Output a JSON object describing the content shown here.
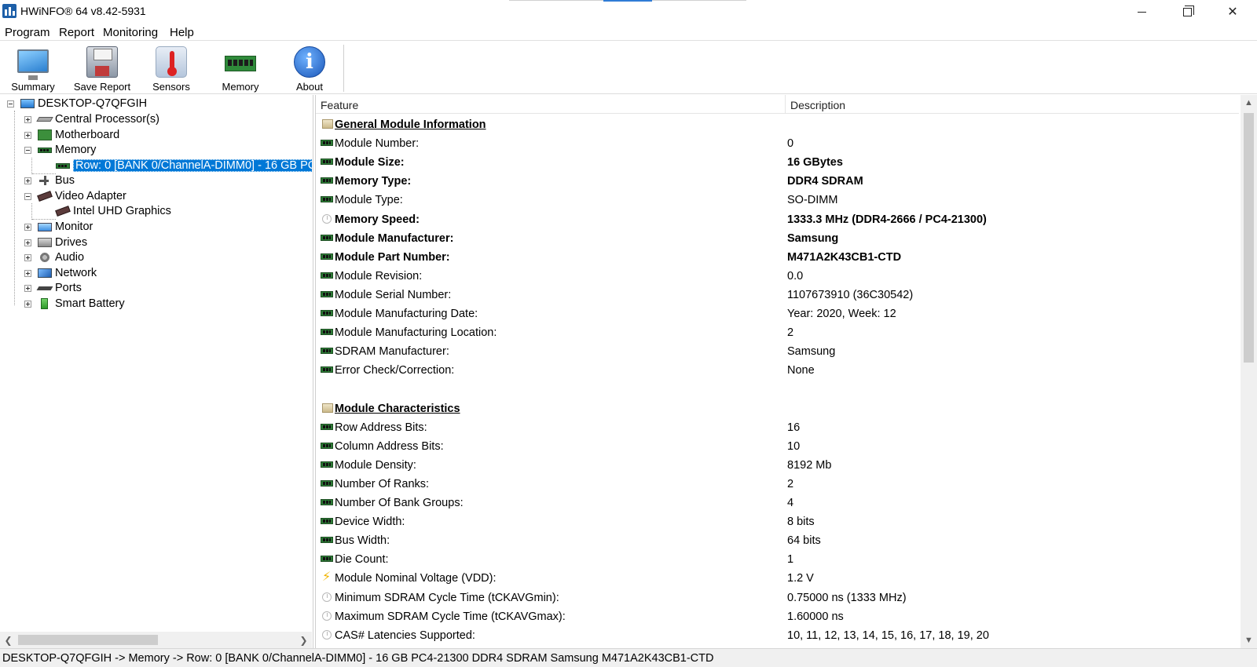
{
  "window": {
    "title": "HWiNFO® 64 v8.42-5931",
    "minimize_glyph": "—",
    "close_glyph": "✕"
  },
  "menu": [
    "Program",
    "Report",
    "Monitoring",
    "Help"
  ],
  "toolbar": [
    {
      "label": "Summary",
      "icon": "monitor-icon"
    },
    {
      "label": "Save Report",
      "icon": "floppy-disk-icon"
    },
    {
      "label": "Sensors",
      "icon": "thermometer-icon"
    },
    {
      "label": "Memory",
      "icon": "ram-module-icon"
    },
    {
      "label": "About",
      "icon": "info-icon"
    }
  ],
  "about_glyph": "i",
  "tree": {
    "root": "DESKTOP-Q7QFGIH",
    "items": [
      {
        "label": "Central Processor(s)",
        "icon": "cpu-icon",
        "expanded": false
      },
      {
        "label": "Motherboard",
        "icon": "motherboard-icon",
        "expanded": false
      },
      {
        "label": "Memory",
        "icon": "ram-module-icon",
        "expanded": true
      },
      {
        "label": "Row: 0 [BANK 0/ChannelA-DIMM0] - 16 GB PC4-21300 DDR4 SDRAM Samsung M471A2K43CB1-CTD",
        "icon": "ram-module-icon",
        "child": true,
        "selected": true
      },
      {
        "label": "Bus",
        "icon": "bus-icon",
        "expanded": false
      },
      {
        "label": "Video Adapter",
        "icon": "gpu-icon",
        "expanded": true
      },
      {
        "label": "Intel UHD Graphics",
        "icon": "gpu-icon",
        "child": true
      },
      {
        "label": "Monitor",
        "icon": "monitor-icon",
        "expanded": false
      },
      {
        "label": "Drives",
        "icon": "drive-icon",
        "expanded": false
      },
      {
        "label": "Audio",
        "icon": "speaker-icon",
        "expanded": false
      },
      {
        "label": "Network",
        "icon": "network-icon",
        "expanded": false
      },
      {
        "label": "Ports",
        "icon": "port-icon",
        "expanded": false
      },
      {
        "label": "Smart Battery",
        "icon": "battery-icon",
        "expanded": false
      }
    ]
  },
  "details": {
    "columns": {
      "feature": "Feature",
      "description": "Description"
    },
    "rows": [
      {
        "type": "section",
        "feature": "General Module Information",
        "description": ""
      },
      {
        "icon": "ram",
        "feature": "Module Number:",
        "description": "0"
      },
      {
        "icon": "ram",
        "feature": "Module Size:",
        "description": "16 GBytes",
        "bold": true
      },
      {
        "icon": "ram",
        "feature": "Memory Type:",
        "description": "DDR4 SDRAM",
        "bold": true
      },
      {
        "icon": "ram",
        "feature": "Module Type:",
        "description": "SO-DIMM"
      },
      {
        "icon": "clock",
        "feature": "Memory Speed:",
        "description": "1333.3 MHz (DDR4-2666 / PC4-21300)",
        "bold": true
      },
      {
        "icon": "ram",
        "feature": "Module Manufacturer:",
        "description": "Samsung",
        "bold": true
      },
      {
        "icon": "ram",
        "feature": "Module Part Number:",
        "description": "M471A2K43CB1-CTD",
        "bold": true
      },
      {
        "icon": "ram",
        "feature": "Module Revision:",
        "description": "0.0"
      },
      {
        "icon": "ram",
        "feature": "Module Serial Number:",
        "description": "1107673910 (36C30542)"
      },
      {
        "icon": "ram",
        "feature": "Module Manufacturing Date:",
        "description": "Year: 2020, Week: 12"
      },
      {
        "icon": "ram",
        "feature": "Module Manufacturing Location:",
        "description": "2"
      },
      {
        "icon": "ram",
        "feature": "SDRAM Manufacturer:",
        "description": "Samsung"
      },
      {
        "icon": "ram",
        "feature": "Error Check/Correction:",
        "description": "None"
      },
      {
        "type": "blank",
        "feature": "",
        "description": ""
      },
      {
        "type": "section",
        "feature": "Module Characteristics",
        "description": ""
      },
      {
        "icon": "ram",
        "feature": "Row Address Bits:",
        "description": "16"
      },
      {
        "icon": "ram",
        "feature": "Column Address Bits:",
        "description": "10"
      },
      {
        "icon": "ram",
        "feature": "Module Density:",
        "description": "8192 Mb"
      },
      {
        "icon": "ram",
        "feature": "Number Of Ranks:",
        "description": "2"
      },
      {
        "icon": "ram",
        "feature": "Number Of Bank Groups:",
        "description": "4"
      },
      {
        "icon": "ram",
        "feature": "Device Width:",
        "description": "8 bits"
      },
      {
        "icon": "ram",
        "feature": "Bus Width:",
        "description": "64 bits"
      },
      {
        "icon": "ram",
        "feature": "Die Count:",
        "description": "1"
      },
      {
        "icon": "bolt",
        "feature": "Module Nominal Voltage (VDD):",
        "description": "1.2 V"
      },
      {
        "icon": "clock",
        "feature": "Minimum SDRAM Cycle Time (tCKAVGmin):",
        "description": "0.75000 ns (1333 MHz)"
      },
      {
        "icon": "clock",
        "feature": "Maximum SDRAM Cycle Time (tCKAVGmax):",
        "description": "1.60000 ns"
      },
      {
        "icon": "clock",
        "feature": "CAS# Latencies Supported:",
        "description": "10, 11, 12, 13, 14, 15, 16, 17, 18, 19, 20"
      }
    ]
  },
  "status": "DESKTOP-Q7QFGIH -> Memory -> Row: 0 [BANK 0/ChannelA-DIMM0] - 16 GB PC4-21300 DDR4 SDRAM Samsung M471A2K43CB1-CTD",
  "scroll": {
    "up": "▲",
    "down": "▼",
    "left": "❮",
    "right": "❯"
  }
}
